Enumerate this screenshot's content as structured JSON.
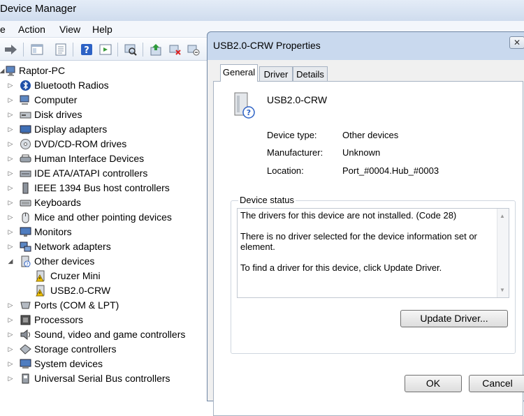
{
  "device_manager": {
    "title": "Device Manager",
    "menu": [
      "e",
      "Action",
      "View",
      "Help"
    ],
    "toolbar_icons": [
      "forward-arrow-icon",
      "properties-icon",
      "show-hide-icon",
      "help-icon",
      "action-icon",
      "scan-hardware-icon",
      "update-driver-icon",
      "uninstall-icon",
      "disable-icon"
    ],
    "tree": {
      "root": "Raptor-PC",
      "items": [
        {
          "label": "Bluetooth Radios",
          "icon": "bluetooth-icon",
          "expanded": false
        },
        {
          "label": "Computer",
          "icon": "computer-icon",
          "expanded": false
        },
        {
          "label": "Disk drives",
          "icon": "disk-drive-icon",
          "expanded": false
        },
        {
          "label": "Display adapters",
          "icon": "display-adapter-icon",
          "expanded": false
        },
        {
          "label": "DVD/CD-ROM drives",
          "icon": "dvd-drive-icon",
          "expanded": false
        },
        {
          "label": "Human Interface Devices",
          "icon": "hid-icon",
          "expanded": false
        },
        {
          "label": "IDE ATA/ATAPI controllers",
          "icon": "ide-controller-icon",
          "expanded": false
        },
        {
          "label": "IEEE 1394 Bus host controllers",
          "icon": "ieee1394-icon",
          "expanded": false
        },
        {
          "label": "Keyboards",
          "icon": "keyboard-icon",
          "expanded": false
        },
        {
          "label": "Mice and other pointing devices",
          "icon": "mouse-icon",
          "expanded": false
        },
        {
          "label": "Monitors",
          "icon": "monitor-icon",
          "expanded": false
        },
        {
          "label": "Network adapters",
          "icon": "network-adapter-icon",
          "expanded": false
        },
        {
          "label": "Other devices",
          "icon": "other-devices-icon",
          "expanded": true,
          "children": [
            {
              "label": "Cruzer Mini",
              "icon": "warning-device-icon"
            },
            {
              "label": "USB2.0-CRW",
              "icon": "warning-device-icon"
            }
          ]
        },
        {
          "label": "Ports (COM & LPT)",
          "icon": "port-icon",
          "expanded": false
        },
        {
          "label": "Processors",
          "icon": "processor-icon",
          "expanded": false
        },
        {
          "label": "Sound, video and game controllers",
          "icon": "sound-icon",
          "expanded": false
        },
        {
          "label": "Storage controllers",
          "icon": "storage-controller-icon",
          "expanded": false
        },
        {
          "label": "System devices",
          "icon": "system-device-icon",
          "expanded": false
        },
        {
          "label": "Universal Serial Bus controllers",
          "icon": "usb-controller-icon",
          "expanded": false
        }
      ]
    }
  },
  "properties_dialog": {
    "title": "USB2.0-CRW Properties",
    "close_label": "✕",
    "tabs": [
      "General",
      "Driver",
      "Details"
    ],
    "active_tab": "General",
    "device_name": "USB2.0-CRW",
    "fields": [
      {
        "label": "Device type:",
        "value": "Other devices"
      },
      {
        "label": "Manufacturer:",
        "value": "Unknown"
      },
      {
        "label": "Location:",
        "value": "Port_#0004.Hub_#0003"
      }
    ],
    "status_label": "Device status",
    "status_lines": [
      "The drivers for this device are not installed. (Code 28)",
      "There is no driver selected for the device information set or element.",
      "To find a driver for this device, click Update Driver."
    ],
    "update_driver_label": "Update Driver...",
    "ok_label": "OK",
    "cancel_label": "Cancel"
  }
}
